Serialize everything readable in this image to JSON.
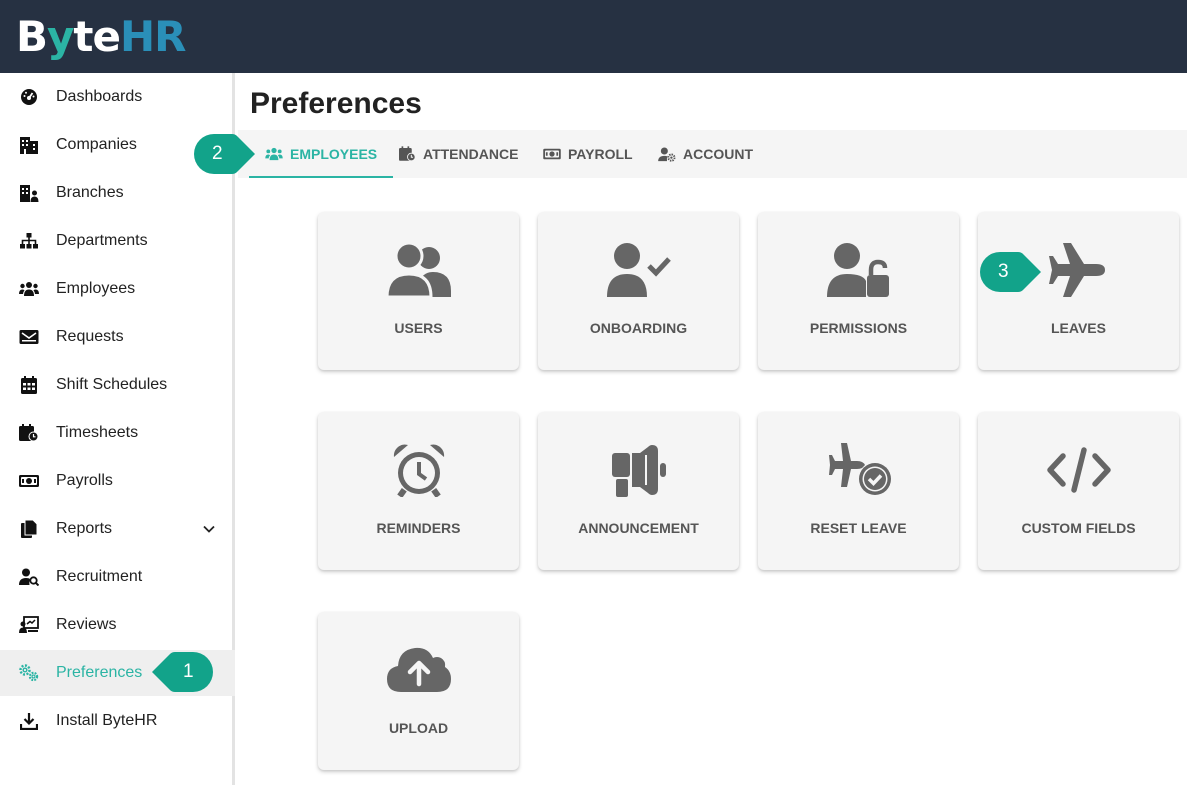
{
  "app": {
    "logo": {
      "b": "B",
      "y": "y",
      "te": "te",
      "hr": "HR"
    }
  },
  "sidebar": {
    "items": [
      {
        "label": "Dashboards",
        "icon": "dashboard-icon"
      },
      {
        "label": "Companies",
        "icon": "building-icon"
      },
      {
        "label": "Branches",
        "icon": "branch-building-icon"
      },
      {
        "label": "Departments",
        "icon": "sitemap-icon"
      },
      {
        "label": "Employees",
        "icon": "users-icon"
      },
      {
        "label": "Requests",
        "icon": "envelope-icon"
      },
      {
        "label": "Shift Schedules",
        "icon": "calendar-icon"
      },
      {
        "label": "Timesheets",
        "icon": "calendar-clock-icon"
      },
      {
        "label": "Payrolls",
        "icon": "money-icon"
      },
      {
        "label": "Reports",
        "icon": "file-icon"
      },
      {
        "label": "Recruitment",
        "icon": "user-search-icon"
      },
      {
        "label": "Reviews",
        "icon": "review-board-icon"
      },
      {
        "label": "Preferences",
        "icon": "gears-icon",
        "active": true
      },
      {
        "label": "Install ByteHR",
        "icon": "download-icon"
      }
    ]
  },
  "main": {
    "title": "Preferences",
    "tabs": [
      {
        "label": "EMPLOYEES",
        "icon": "users-icon",
        "active": true
      },
      {
        "label": "ATTENDANCE",
        "icon": "calendar-clock-icon"
      },
      {
        "label": "PAYROLL",
        "icon": "money-icon"
      },
      {
        "label": "ACCOUNT",
        "icon": "user-gear-icon"
      }
    ],
    "cards": [
      {
        "label": "USERS",
        "icon": "users-icon"
      },
      {
        "label": "ONBOARDING",
        "icon": "user-check-icon"
      },
      {
        "label": "PERMISSIONS",
        "icon": "user-lock-icon"
      },
      {
        "label": "LEAVES",
        "icon": "plane-icon"
      },
      {
        "label": "REMINDERS",
        "icon": "alarm-clock-icon"
      },
      {
        "label": "ANNOUNCEMENT",
        "icon": "megaphone-icon"
      },
      {
        "label": "RESET LEAVE",
        "icon": "plane-check-icon"
      },
      {
        "label": "CUSTOM FIELDS",
        "icon": "code-icon"
      },
      {
        "label": "UPLOAD",
        "icon": "cloud-upload-icon"
      }
    ]
  },
  "callouts": [
    "1",
    "2",
    "3"
  ],
  "colors": {
    "accent": "#2bb4a4",
    "topbar": "#263142",
    "callout": "#12a38a",
    "icon": "#666666"
  }
}
